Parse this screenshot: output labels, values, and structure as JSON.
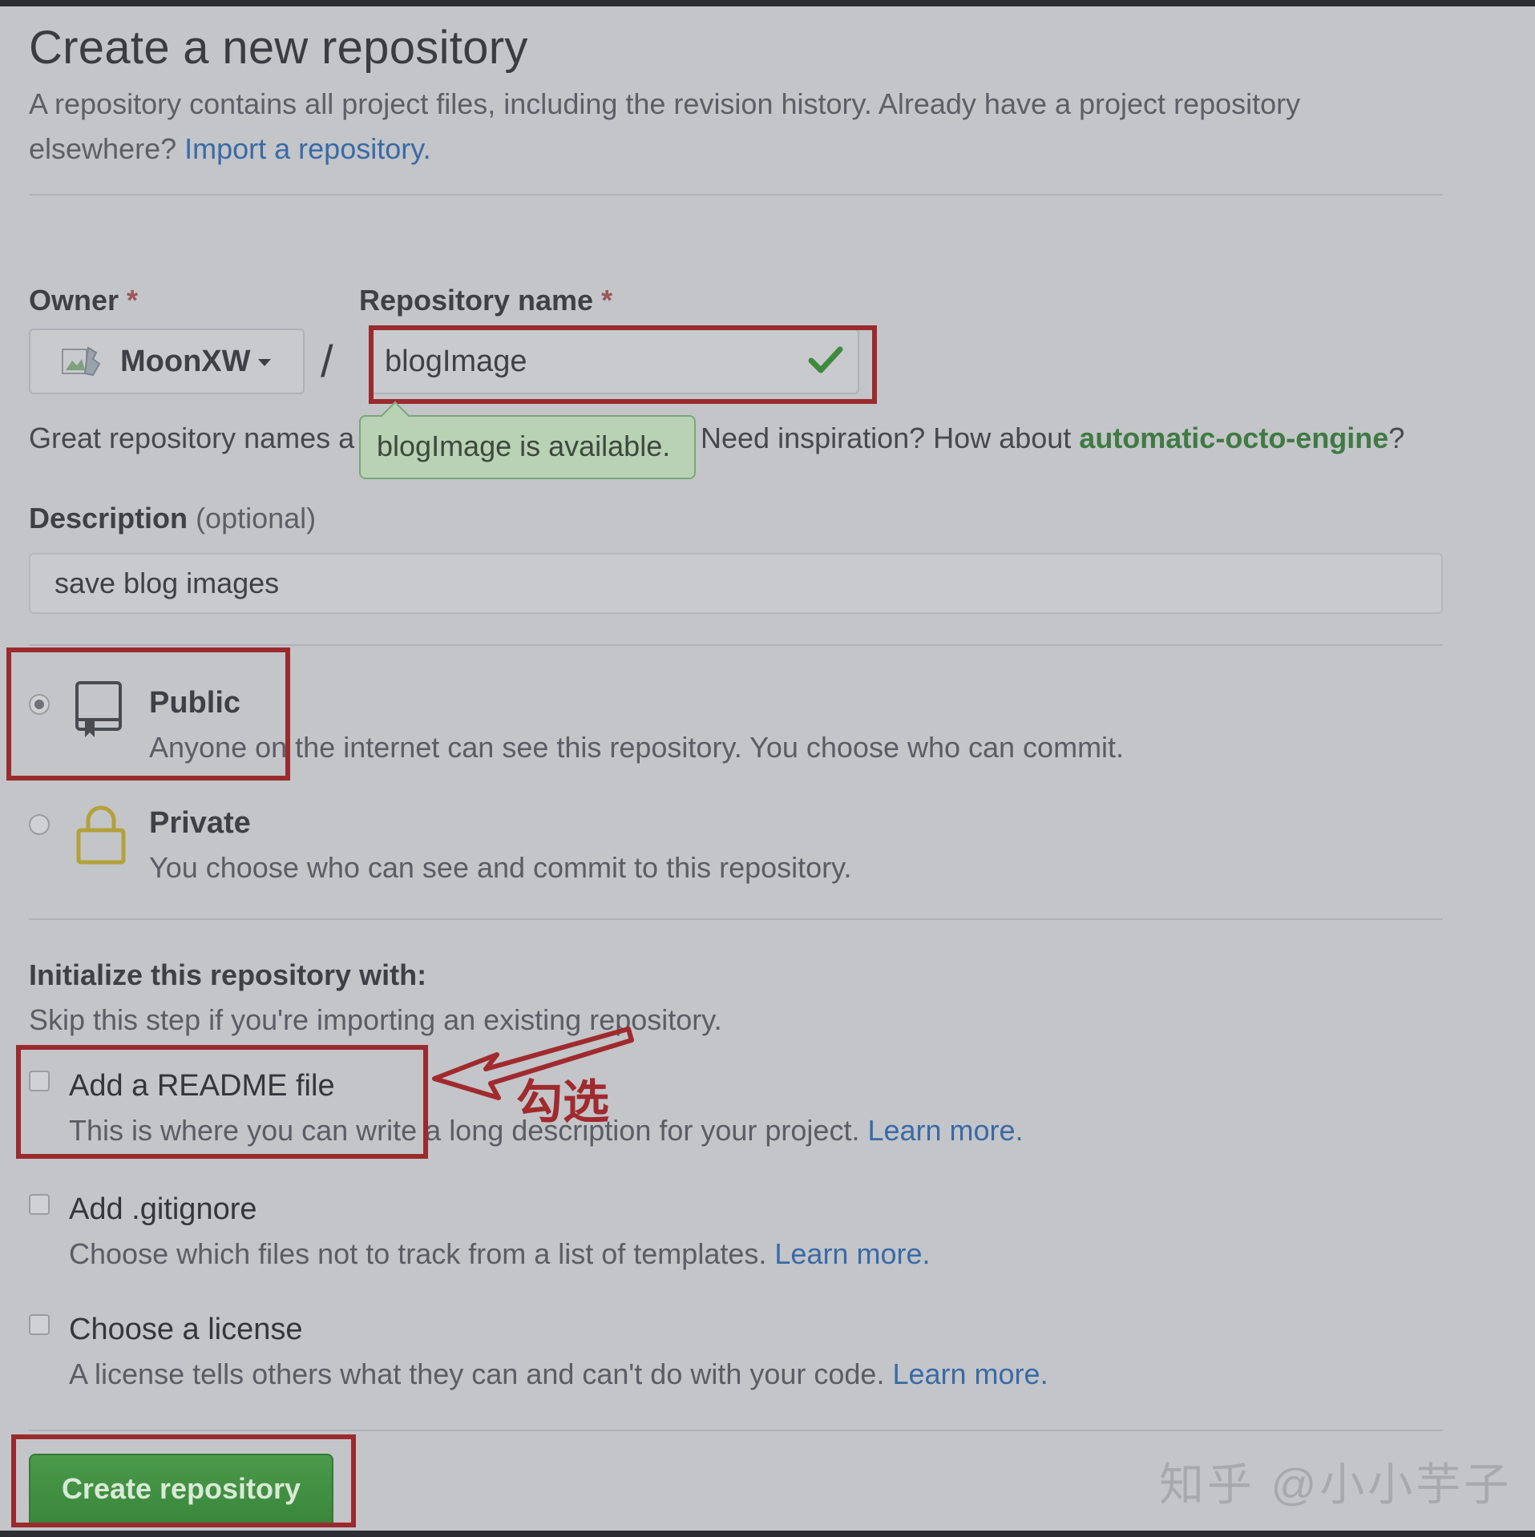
{
  "header": {
    "title": "Create a new repository",
    "lead_line1": "A repository contains all project files, including the revision history. Already have a project repository",
    "lead_line2_prefix": "elsewhere? ",
    "import_link": "Import a repository."
  },
  "owner": {
    "label": "Owner",
    "required_mark": "*",
    "selected": "MoonXW"
  },
  "repo_name": {
    "label": "Repository name",
    "required_mark": "*",
    "value": "blogImage",
    "availability_tooltip": "blogImage is available."
  },
  "slash": "/",
  "hint": {
    "prefix": "Great repository names a",
    "inspiration": "Need inspiration? How about ",
    "suggestion": "automatic-octo-engine",
    "suffix": "?"
  },
  "description": {
    "label": "Description",
    "optional": "(optional)",
    "value": "save blog images"
  },
  "visibility": {
    "selected": "Public",
    "options": [
      {
        "title": "Public",
        "desc": "Anyone on the internet can see this repository. You choose who can commit."
      },
      {
        "title": "Private",
        "desc": "You choose who can see and commit to this repository."
      }
    ]
  },
  "initialize": {
    "heading": "Initialize this repository with:",
    "subheading": "Skip this step if you're importing an existing repository.",
    "options": [
      {
        "title": "Add a README file",
        "desc": "This is where you can write a long description for your project. ",
        "link": "Learn more."
      },
      {
        "title": "Add .gitignore",
        "desc": "Choose which files not to track from a list of templates. ",
        "link": "Learn more."
      },
      {
        "title": "Choose a license",
        "desc": "A license tells others what they can and can't do with your code. ",
        "link": "Learn more."
      }
    ]
  },
  "create_button": "Create repository",
  "annotation": "勾选",
  "watermark": "知乎 @小小芋子",
  "colors": {
    "highlight_box": "#9a2a2e",
    "button": "#3a873c",
    "link": "#3a6aa6",
    "suggestion": "#3f7a43"
  }
}
